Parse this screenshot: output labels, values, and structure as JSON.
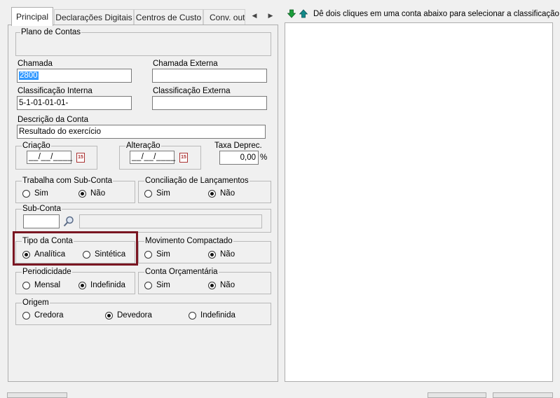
{
  "tabs": [
    {
      "label": "Principal",
      "active": true
    },
    {
      "label": "Declarações Digitais"
    },
    {
      "label": "Centros de Custo"
    },
    {
      "label": "Conv. outra"
    }
  ],
  "icons": {
    "tab_scroll_left": "◀",
    "tab_scroll_right": "▶",
    "arrow_down": "down-arrow-icon",
    "arrow_up": "up-arrow-icon",
    "search": "magnifier-icon",
    "calendar": "calendar-icon"
  },
  "calendar_glyph": "15",
  "right_panel": {
    "hint": "Dê dois cliques em uma conta abaixo para selecionar a classificação"
  },
  "plano_de_contas": {
    "title": "Plano de Contas"
  },
  "fields": {
    "chamada": {
      "label": "Chamada",
      "value": "2800"
    },
    "chamada_externa": {
      "label": "Chamada Externa",
      "value": ""
    },
    "classificacao_interna": {
      "label": "Classificação Interna",
      "value": "5-1-01-01-01-"
    },
    "classificacao_externa": {
      "label": "Classificação Externa",
      "value": ""
    },
    "descricao": {
      "label": "Descrição da Conta",
      "value": "Resultado do exercício"
    }
  },
  "criacao": {
    "title": "Criação",
    "value": "__/__/____"
  },
  "alteracao": {
    "title": "Alteração",
    "value": "__/__/____"
  },
  "taxa_deprec": {
    "label": "Taxa Deprec.",
    "value": "0,00",
    "unit": "%"
  },
  "trabalha_sub_conta": {
    "title": "Trabalha com Sub-Conta",
    "options": [
      "Sim",
      "Não"
    ],
    "selected": 1
  },
  "conciliacao": {
    "title": "Conciliação de Lançamentos",
    "options": [
      "Sim",
      "Não"
    ],
    "selected": 1
  },
  "sub_conta": {
    "title": "Sub-Conta",
    "value": "",
    "description": ""
  },
  "tipo_conta": {
    "title": "Tipo da Conta",
    "options": [
      "Analítica",
      "Sintética"
    ],
    "selected": 0
  },
  "movimento_compactado": {
    "title": "Movimento Compactado",
    "options": [
      "Sim",
      "Não"
    ],
    "selected": 1
  },
  "periodicidade": {
    "title": "Periodicidade",
    "options": [
      "Mensal",
      "Indefinida"
    ],
    "selected": 1
  },
  "conta_orcamentaria": {
    "title": "Conta Orçamentária",
    "options": [
      "Sim",
      "Não"
    ],
    "selected": 1
  },
  "origem": {
    "title": "Origem",
    "options": [
      "Credora",
      "Devedora",
      "Indefinida"
    ],
    "selected": 1
  },
  "colors": {
    "highlight": "#7a1622",
    "selection": "#3399ff",
    "arrow_green": "#1a9e3a",
    "arrow_teal": "#128a8a"
  }
}
